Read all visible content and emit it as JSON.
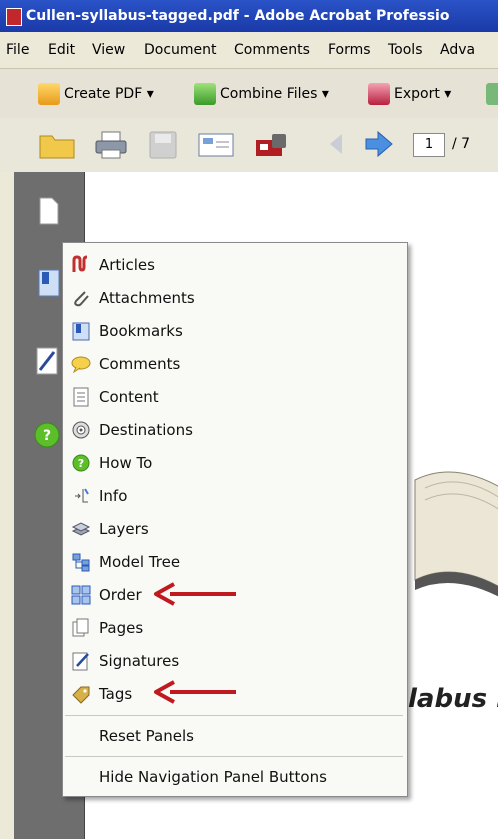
{
  "window": {
    "title": "Cullen-syllabus-tagged.pdf - Adobe Acrobat Professio"
  },
  "menubar": {
    "items": [
      "File",
      "Edit",
      "View",
      "Document",
      "Comments",
      "Forms",
      "Tools",
      "Adva"
    ]
  },
  "toolbar1": {
    "create_pdf": "Create PDF",
    "combine_files": "Combine Files",
    "export": "Export",
    "dropdown_glyph": "▾"
  },
  "toolbar2": {
    "page_number": "1",
    "page_count": "/ 7"
  },
  "document": {
    "visible_text": "labus i"
  },
  "context_menu": {
    "items": [
      "Articles",
      "Attachments",
      "Bookmarks",
      "Comments",
      "Content",
      "Destinations",
      "How To",
      "Info",
      "Layers",
      "Model Tree",
      "Order",
      "Pages",
      "Signatures",
      "Tags"
    ],
    "reset_panels": "Reset Panels",
    "hide_buttons": "Hide Navigation Panel Buttons"
  },
  "colors": {
    "arrow": "#c0191f",
    "titlebar": "#1f42b6",
    "nav_panel": "#6e6e6e"
  }
}
